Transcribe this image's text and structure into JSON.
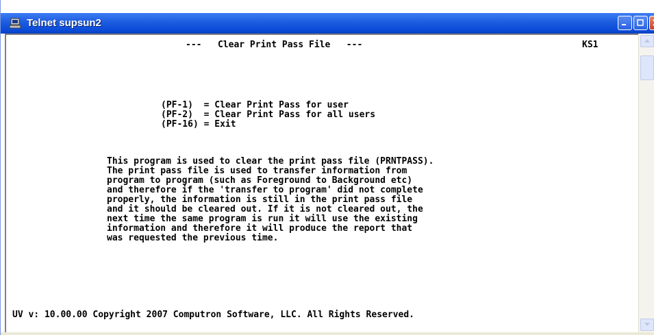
{
  "window": {
    "title": "Telnet supsun2",
    "icon": "telnet-terminal-icon"
  },
  "screen": {
    "header_title": "---   Clear Print Pass File   ---",
    "screen_id": "KS1",
    "pf_options": [
      "(PF-1)  = Clear Print Pass for user",
      "(PF-2)  = Clear Print Pass for all users",
      "(PF-16) = Exit"
    ],
    "description_lines": [
      "This program is used to clear the print pass file (PRNTPASS).",
      "The print pass file is used to transfer information from",
      "program to program (such as Foreground to Background etc)",
      "and therefore if the 'transfer to program' did not complete",
      "properly, the information is still in the print pass file",
      "and it should be cleared out. If it is not cleared out, the",
      "next time the same program is run it will use the existing",
      "information and therefore it will produce the report that",
      "was requested the previous time."
    ],
    "footer": "UV v: 10.00.00 Copyright 2007 Computron Software, LLC. All Rights Reserved."
  },
  "colors": {
    "titlebar": "#0a4ad8",
    "terminal_background": "#ffffff",
    "terminal_text": "#000000"
  }
}
